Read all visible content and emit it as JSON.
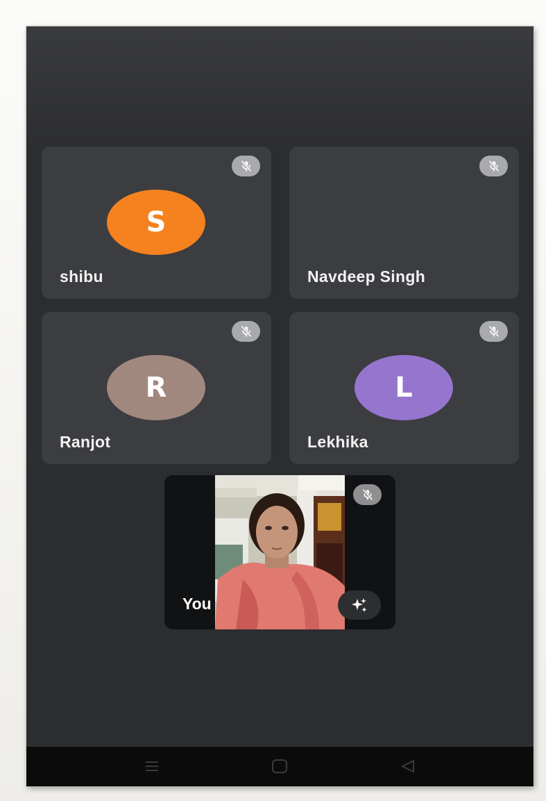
{
  "meeting": {
    "participants": [
      {
        "name": "shibu",
        "initial": "S",
        "avatar_color": "#f5821f",
        "muted": true
      },
      {
        "name": "Navdeep Singh",
        "initial": "",
        "avatar_color": "",
        "muted": true
      },
      {
        "name": "Ranjot",
        "initial": "R",
        "avatar_color": "#a1887f",
        "muted": true
      },
      {
        "name": "Lekhika",
        "initial": "L",
        "avatar_color": "#9575cd",
        "muted": true
      }
    ],
    "self": {
      "name": "You",
      "muted": true,
      "has_video": true
    }
  },
  "icons": {
    "mute": "mic-off-icon",
    "effects": "sparkle-effects-icon",
    "nav": [
      "recents-menu-icon",
      "home-square-icon",
      "back-triangle-icon"
    ]
  },
  "colors": {
    "screen_bg": "#2c2d2f",
    "tile_bg": "#3c3d40",
    "badge_bg": "#a9aaad"
  }
}
